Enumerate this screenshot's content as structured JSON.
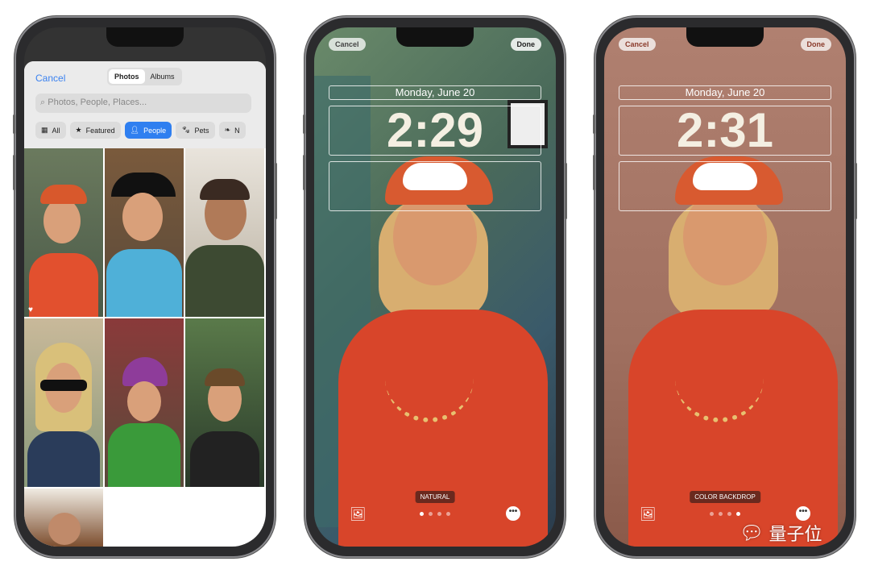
{
  "picker": {
    "cancel": "Cancel",
    "tabs": [
      "Photos",
      "Albums"
    ],
    "search_placeholder": "Photos, People, Places...",
    "chips": [
      {
        "label": "All",
        "icon": "grid-icon"
      },
      {
        "label": "Featured",
        "icon": "star-icon"
      },
      {
        "label": "People",
        "icon": "person-icon",
        "selected": true
      },
      {
        "label": "Pets",
        "icon": "paw-icon"
      },
      {
        "label": "N",
        "icon": "leaf-icon"
      }
    ]
  },
  "lock_natural": {
    "cancel": "Cancel",
    "done": "Done",
    "date": "Monday, June 20",
    "time": "2:29",
    "style_label": "NATURAL",
    "page_index": 1,
    "page_count": 4
  },
  "lock_backdrop": {
    "cancel": "Cancel",
    "done": "Done",
    "date": "Monday, June 20",
    "time": "2:31",
    "style_label": "COLOR BACKDROP",
    "page_index": 4,
    "page_count": 4
  },
  "watermark": "量子位",
  "colors": {
    "accent": "#2f7ff0",
    "shirt": "#d8452a",
    "backdrop": "#b98a7a"
  }
}
